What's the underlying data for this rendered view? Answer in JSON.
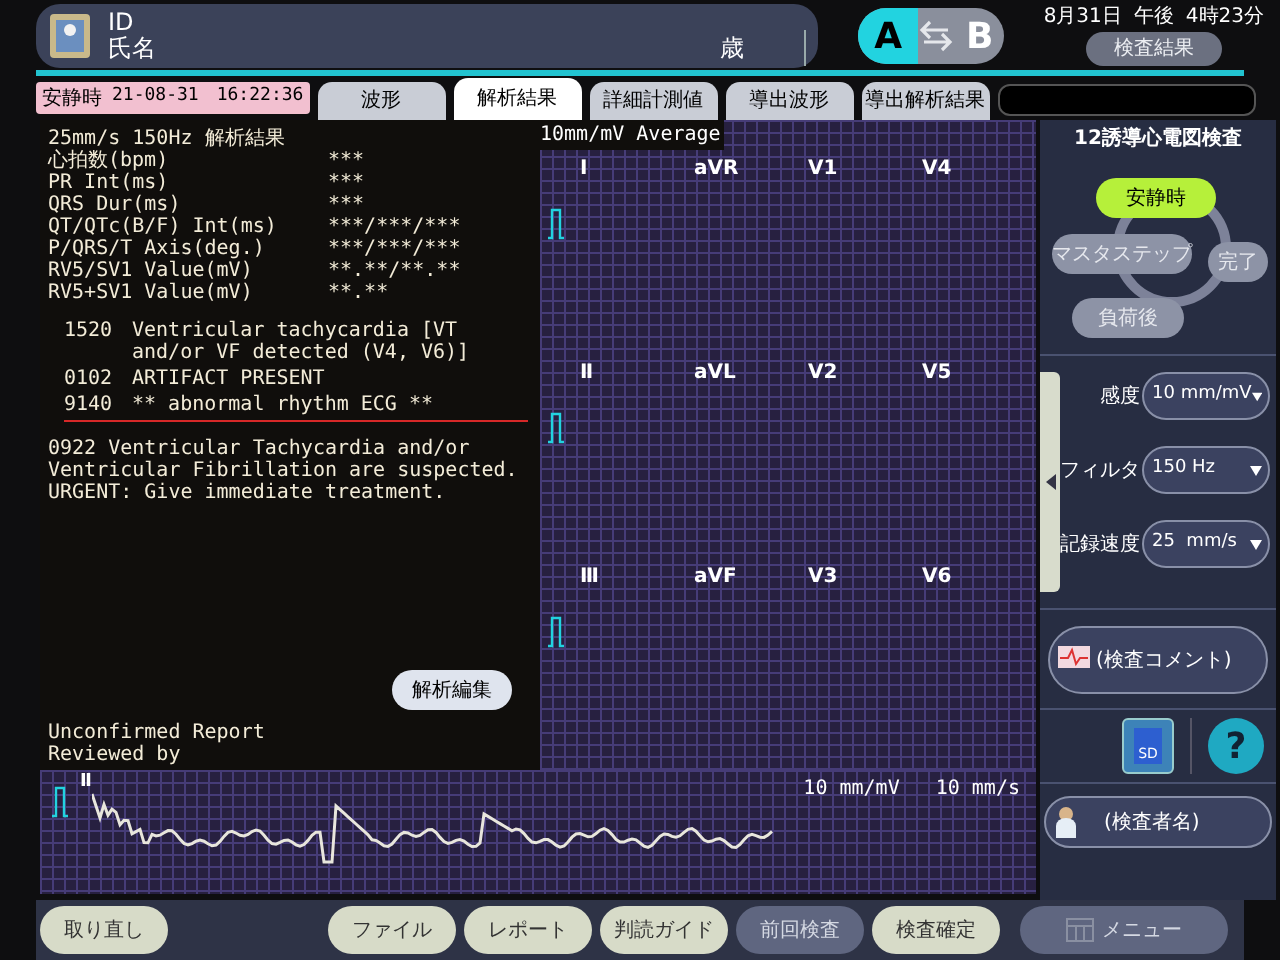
{
  "header": {
    "id_label": "ID",
    "name_label": "氏名",
    "age_unit": "歳",
    "switch": [
      {
        "label": "A",
        "selected": true
      },
      {
        "label": "B",
        "selected": false
      }
    ],
    "date": "8月31日",
    "ampm": "午後",
    "time": "4時23分",
    "result_button": {
      "label": "検査結果",
      "disabled": true
    }
  },
  "status": {
    "mode": "安静時",
    "timestamp": "21-08-31　16:22:36"
  },
  "tabs": [
    {
      "label": "波形",
      "selected": false
    },
    {
      "label": "解析結果",
      "selected": true
    },
    {
      "label": "詳細計測値",
      "selected": false
    },
    {
      "label": "導出波形",
      "selected": false
    },
    {
      "label": "導出解析結果",
      "selected": false
    }
  ],
  "report": {
    "heading": "25mm/s 150Hz 解析結果",
    "measurements": [
      {
        "label": "心拍数(bpm)",
        "value": "***"
      },
      {
        "label": "PR Int(ms)",
        "value": "***"
      },
      {
        "label": "QRS Dur(ms)",
        "value": "***"
      },
      {
        "label": "QT/QTc(B/F) Int(ms)",
        "value": "***/***/***"
      },
      {
        "label": "P/QRS/T Axis(deg.)",
        "value": "***/***/***"
      },
      {
        "label": "RV5/SV1 Value(mV)",
        "value": "**.**/**.**"
      },
      {
        "label": "RV5+SV1 Value(mV)",
        "value": "**.**"
      }
    ],
    "findings": [
      {
        "code": "1520",
        "text": "Ventricular tachycardia [VT and/or VF detected (V4, V6)]"
      },
      {
        "code": "0102",
        "text": "ARTIFACT PRESENT"
      },
      {
        "code": "9140",
        "text": "**  abnormal rhythm ECG  **"
      }
    ],
    "comment": "0922  Ventricular Tachycardia and/or Ventricular Fibrillation are suspected. URGENT: Give immediate treatment.",
    "edit_button": "解析編集",
    "status_lines": [
      "Unconfirmed Report",
      "Reviewed by"
    ]
  },
  "grid": {
    "title": "10mm/mV Average",
    "rows": [
      [
        "I",
        "aVR",
        "V1",
        "V4"
      ],
      [
        "Ⅱ",
        "aVL",
        "V2",
        "V5"
      ],
      [
        "Ⅲ",
        "aVF",
        "V3",
        "V6"
      ]
    ]
  },
  "rhythm_strip": {
    "lead": "Ⅱ",
    "sensitivity": "10 mm/mV",
    "speed": "10 mm/s"
  },
  "sidebar": {
    "title": "12誘導心電図検査",
    "steps": [
      {
        "label": "安静時",
        "selected": true
      },
      {
        "label": "マスタステップ",
        "selected": false
      },
      {
        "label": "完了",
        "selected": false
      },
      {
        "label": "負荷後",
        "selected": false
      }
    ],
    "settings": [
      {
        "label": "感度",
        "value": "10 mm/mV"
      },
      {
        "label": "フィルタ",
        "value": "150 Hz"
      },
      {
        "label": "記録速度",
        "value": "25  mm/s"
      }
    ],
    "comment_button": "(検査コメント)",
    "sd_label": "SD",
    "help_label": "?",
    "examiner_button": "(検査者名)"
  },
  "bottom_buttons": [
    {
      "label": "取り直し",
      "disabled": false
    },
    {
      "label": "ファイル",
      "disabled": false
    },
    {
      "label": "レポート",
      "disabled": false
    },
    {
      "label": "判読ガイド",
      "disabled": false
    },
    {
      "label": "前回検査",
      "disabled": true
    },
    {
      "label": "検査確定",
      "disabled": false
    },
    {
      "label": "メニュー",
      "disabled": true
    }
  ]
}
